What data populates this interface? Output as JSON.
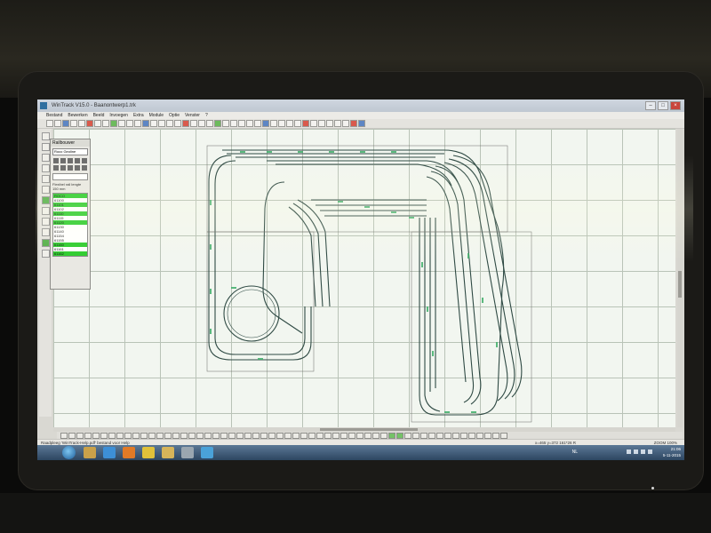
{
  "window": {
    "title": "WinTrack V15.0 - Baanontwerp1.trk",
    "buttons": [
      "–",
      "□",
      "×"
    ]
  },
  "menu": [
    "Bestand",
    "Bewerken",
    "Beeld",
    "Invoegen",
    "Extra",
    "Module",
    "Optie",
    "Venster",
    "?"
  ],
  "toolbar": {
    "icon_count": 40
  },
  "panel": {
    "title": "Railbouwer",
    "select_value": "Roco Geoline",
    "field_label": "Flexibel rail lengte",
    "field_value": "150 mm",
    "list": [
      {
        "text": "ROCO",
        "highlight": true
      },
      {
        "text": "61100",
        "highlight": false
      },
      {
        "text": "61101",
        "highlight": true
      },
      {
        "text": "61102",
        "highlight": false
      },
      {
        "text": "61110",
        "highlight": true
      },
      {
        "text": "61115",
        "highlight": false
      },
      {
        "text": "61120",
        "highlight": true
      },
      {
        "text": "61130",
        "highlight": false
      },
      {
        "text": "61140",
        "highlight": false
      },
      {
        "text": "61154",
        "highlight": false
      },
      {
        "text": "61155",
        "highlight": false
      },
      {
        "text": "61160",
        "highlight": true
      },
      {
        "text": "61161",
        "highlight": false
      },
      {
        "text": "61162",
        "highlight": true
      },
      {
        "text": "61164",
        "highlight": true
      }
    ]
  },
  "status": {
    "help_text": "Raadpleeg 'WinTrack-Help.pdf' bestand voor Help",
    "coords": "x=465  y=372  161*26  R",
    "zoom": "ZOOM  100%"
  },
  "taskbar": {
    "language": "NL",
    "time": "21:06",
    "date": "5-11-2015",
    "apps": [
      {
        "name": "explorer-icon",
        "color": "#c9a14a"
      },
      {
        "name": "ie-icon",
        "color": "#3d8fd6"
      },
      {
        "name": "media-player-icon",
        "color": "#e07a27"
      },
      {
        "name": "chrome-icon",
        "color": "#e0c13a"
      },
      {
        "name": "folder-icon",
        "color": "#d6b45a"
      },
      {
        "name": "wintrack-icon",
        "color": "#9aa6b0"
      },
      {
        "name": "network-icon",
        "color": "#4aa2d9"
      }
    ]
  },
  "colors": {
    "track": "#2f4a44",
    "track_label": "#3fae6a",
    "grid": "#b9c3b7",
    "canvas": "#f2f6f0",
    "highlight": "#2ecc2e"
  }
}
